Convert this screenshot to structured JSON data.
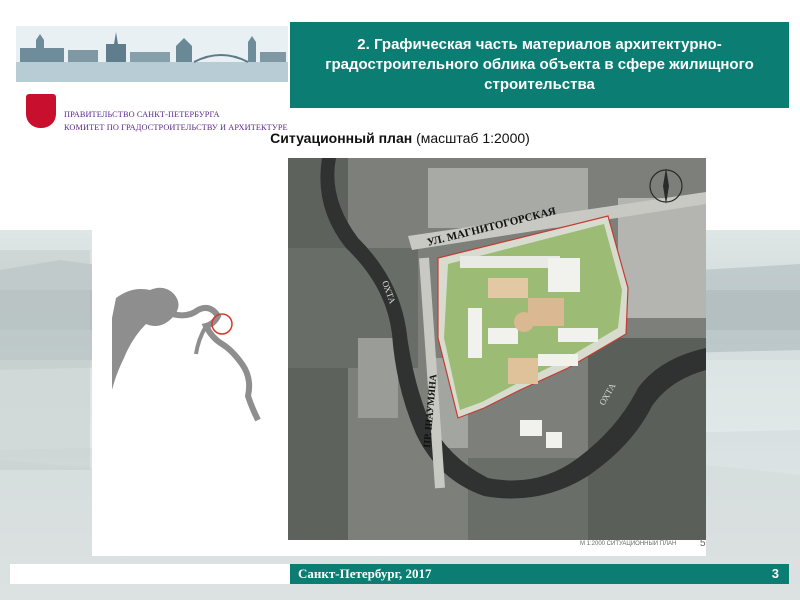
{
  "header": {
    "gov_line1": "ПРАВИТЕЛЬСТВО САНКТ-ПЕТЕРБУРГА",
    "gov_line2": "КОМИТЕТ ПО ГРАДОСТРОИТЕЛЬСТВУ И АРХИТЕКТУРЕ",
    "title": "2. Графическая часть материалов архитектурно-градостроительного облика объекта в сфере жилищного строительства"
  },
  "plan": {
    "subtitle": "Ситуационный план",
    "scale": "(масштаб 1:2000)",
    "street_label": "УЛ. МАГНИТОГОРСКАЯ",
    "avenue_label": "ПР. ШАУМЯНА",
    "river_label_1": "ОХТА",
    "river_label_2": "ОХТА",
    "map_caption": "М 1:2000    СИТУАЦИОННЫЙ ПЛАН",
    "page_in_doc": "5"
  },
  "footer": {
    "city_year": "Санкт-Петербург, 2017",
    "slide_number": "3"
  },
  "colors": {
    "teal": "#0b7d72",
    "emblem_red": "#c8102e",
    "gov_text": "#5b2a8a",
    "locator_circle": "#d23a2a"
  }
}
